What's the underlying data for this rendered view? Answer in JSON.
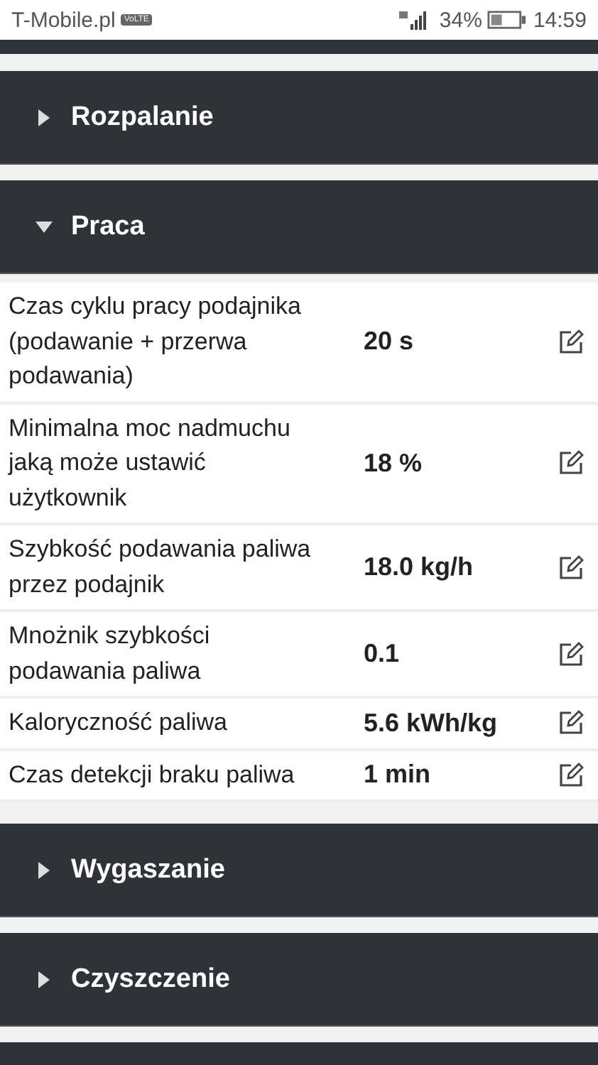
{
  "status_bar": {
    "carrier": "T-Mobile.pl",
    "badge": "VoLTE",
    "battery": "34%",
    "time": "14:59"
  },
  "sections": [
    {
      "title": "Rozpalanie",
      "expanded": false
    },
    {
      "title": "Praca",
      "expanded": true,
      "rows": [
        {
          "label": "Czas cyklu pracy podajnika (podawanie + przerwa podawania)",
          "value": "20 s"
        },
        {
          "label": "Minimalna moc nadmuchu jaką może ustawić użytkownik",
          "value": "18 %"
        },
        {
          "label": "Szybkość podawania paliwa przez podajnik",
          "value": "18.0 kg/h"
        },
        {
          "label": "Mnożnik szybkości podawania paliwa",
          "value": "0.1"
        },
        {
          "label": "Kaloryczność paliwa",
          "value": "5.6 kWh/kg"
        },
        {
          "label": "Czas detekcji braku paliwa",
          "value": "1 min"
        }
      ]
    },
    {
      "title": "Wygaszanie",
      "expanded": false
    },
    {
      "title": "Czyszczenie",
      "expanded": false
    }
  ]
}
